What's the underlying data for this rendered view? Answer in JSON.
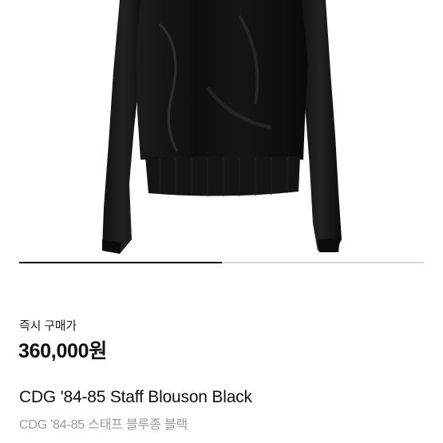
{
  "product": {
    "image_alt": "black blouson jacket",
    "image_progress": 0.5,
    "price_label": "즉시 구매가",
    "price": "360,000원",
    "title": "CDG '84-85 Staff Blouson Black",
    "subtitle": "CDG '84-85 스태프 블루종 블랙"
  },
  "colors": {
    "progress_fill": "#111111",
    "progress_track": "#d8d8d8",
    "subtitle": "#9a9a9a"
  }
}
